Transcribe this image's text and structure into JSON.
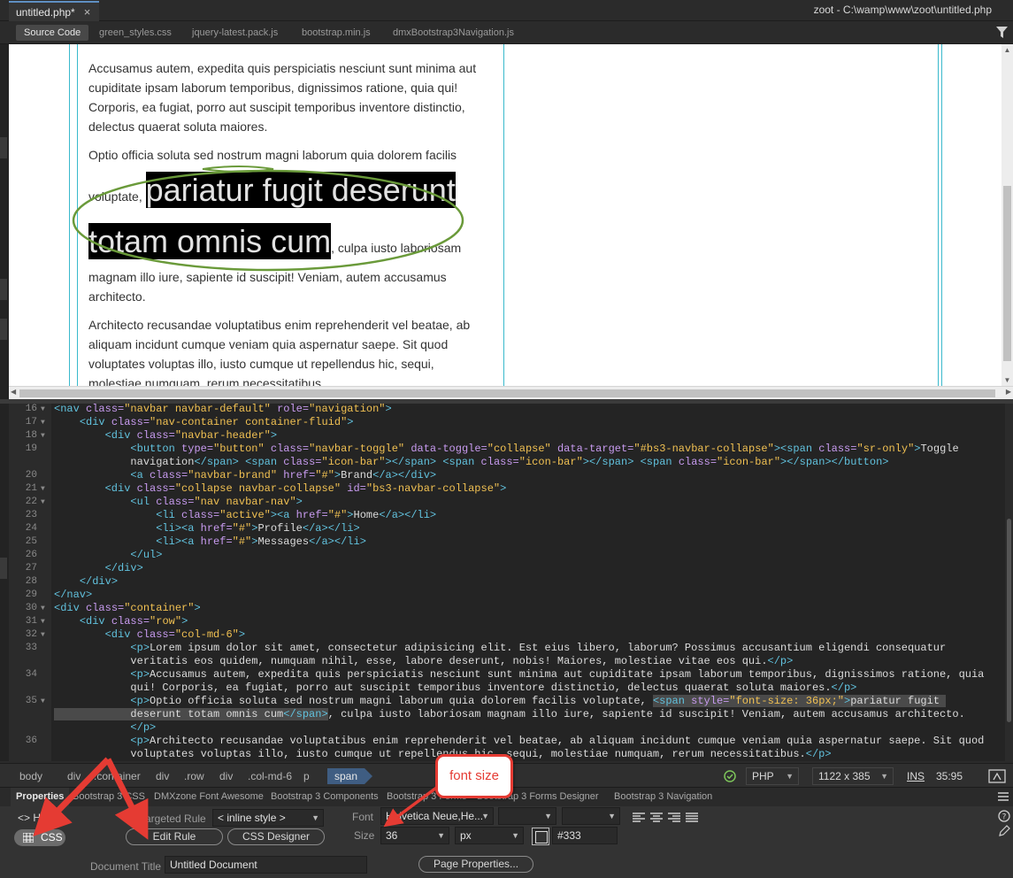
{
  "document_tab": {
    "title": "untitled.php*",
    "close": "×"
  },
  "window_path": "zoot - C:\\wamp\\www\\zoot\\untitled.php",
  "related_files": [
    "Source Code",
    "green_styles.css",
    "jquery-latest.pack.js",
    "bootstrap.min.js",
    "dmxBootstrap3Navigation.js"
  ],
  "live_view": {
    "p1": "Accusamus autem, expedita quis perspiciatis nesciunt sunt minima aut cupiditate ipsam laborum temporibus, dignissimos ratione, quia qui! Corporis, ea fugiat, porro aut suscipit temporibus inventore distinctio, delectus quaerat soluta maiores.",
    "p2_before": "Optio officia soluta sed nostrum magni laborum quia dolorem facilis voluptate, ",
    "p2_span": "pariatur fugit deserunt totam omnis cum",
    "p2_after": ", culpa iusto laboriosam magnam illo iure, sapiente id suscipit! Veniam, autem accusamus architecto.",
    "p3": "Architecto recusandae voluptatibus enim reprehenderit vel beatae, ab aliquam incidunt cumque veniam quia aspernatur saepe. Sit quod voluptates voluptas illo, iusto cumque ut repellendus hic, sequi, molestiae numquam, rerum necessitatibus."
  },
  "code_lines": [
    {
      "n": "16",
      "fold": "▼",
      "html": "<span class=\"tg\">&lt;nav</span> <span class=\"at\">class=</span><span class=\"vl\">\"navbar navbar-default\"</span> <span class=\"at\">role=</span><span class=\"vl\">\"navigation\"</span><span class=\"tg\">&gt;</span>"
    },
    {
      "n": "17",
      "fold": "▼",
      "html": "    <span class=\"tg\">&lt;div</span> <span class=\"at\">class=</span><span class=\"vl\">\"nav-container container-fluid\"</span><span class=\"tg\">&gt;</span>"
    },
    {
      "n": "18",
      "fold": "▼",
      "html": "        <span class=\"tg\">&lt;div</span> <span class=\"at\">class=</span><span class=\"vl\">\"navbar-header\"</span><span class=\"tg\">&gt;</span>"
    },
    {
      "n": "19",
      "fold": "",
      "html": "            <span class=\"tg\">&lt;button</span> <span class=\"at\">type=</span><span class=\"vl\">\"button\"</span> <span class=\"at\">class=</span><span class=\"vl\">\"navbar-toggle\"</span> <span class=\"at\">data-toggle=</span><span class=\"vl\">\"collapse\"</span> <span class=\"at\">data-target=</span><span class=\"vl\">\"#bs3-navbar-collapse\"</span><span class=\"tg\">&gt;&lt;span</span> <span class=\"at\">class=</span><span class=\"vl\">\"sr-only\"</span><span class=\"tg\">&gt;</span>Toggle"
    },
    {
      "n": "",
      "fold": "",
      "html": "            navigation<span class=\"tg\">&lt;/span&gt;</span> <span class=\"tg\">&lt;span</span> <span class=\"at\">class=</span><span class=\"vl\">\"icon-bar\"</span><span class=\"tg\">&gt;&lt;/span&gt;</span> <span class=\"tg\">&lt;span</span> <span class=\"at\">class=</span><span class=\"vl\">\"icon-bar\"</span><span class=\"tg\">&gt;&lt;/span&gt;</span> <span class=\"tg\">&lt;span</span> <span class=\"at\">class=</span><span class=\"vl\">\"icon-bar\"</span><span class=\"tg\">&gt;&lt;/span&gt;&lt;/button&gt;</span>"
    },
    {
      "n": "20",
      "fold": "",
      "html": "            <span class=\"tg\">&lt;a</span> <span class=\"at\">class=</span><span class=\"vl\">\"navbar-brand\"</span> <span class=\"at\">href=</span><span class=\"vl\">\"#\"</span><span class=\"tg\">&gt;</span>Brand<span class=\"tg\">&lt;/a&gt;&lt;/div&gt;</span>"
    },
    {
      "n": "21",
      "fold": "▼",
      "html": "        <span class=\"tg\">&lt;div</span> <span class=\"at\">class=</span><span class=\"vl\">\"collapse navbar-collapse\"</span> <span class=\"at\">id=</span><span class=\"vl\">\"bs3-navbar-collapse\"</span><span class=\"tg\">&gt;</span>"
    },
    {
      "n": "22",
      "fold": "▼",
      "html": "            <span class=\"tg\">&lt;ul</span> <span class=\"at\">class=</span><span class=\"vl\">\"nav navbar-nav\"</span><span class=\"tg\">&gt;</span>"
    },
    {
      "n": "23",
      "fold": "",
      "html": "                <span class=\"tg\">&lt;li</span> <span class=\"at\">class=</span><span class=\"vl\">\"active\"</span><span class=\"tg\">&gt;&lt;a</span> <span class=\"at\">href=</span><span class=\"vl\">\"#\"</span><span class=\"tg\">&gt;</span>Home<span class=\"tg\">&lt;/a&gt;&lt;/li&gt;</span>"
    },
    {
      "n": "24",
      "fold": "",
      "html": "                <span class=\"tg\">&lt;li&gt;&lt;a</span> <span class=\"at\">href=</span><span class=\"vl\">\"#\"</span><span class=\"tg\">&gt;</span>Profile<span class=\"tg\">&lt;/a&gt;&lt;/li&gt;</span>"
    },
    {
      "n": "25",
      "fold": "",
      "html": "                <span class=\"tg\">&lt;li&gt;&lt;a</span> <span class=\"at\">href=</span><span class=\"vl\">\"#\"</span><span class=\"tg\">&gt;</span>Messages<span class=\"tg\">&lt;/a&gt;&lt;/li&gt;</span>"
    },
    {
      "n": "26",
      "fold": "",
      "html": "            <span class=\"tg\">&lt;/ul&gt;</span>"
    },
    {
      "n": "27",
      "fold": "",
      "html": "        <span class=\"tg\">&lt;/div&gt;</span>"
    },
    {
      "n": "28",
      "fold": "",
      "html": "    <span class=\"tg\">&lt;/div&gt;</span>"
    },
    {
      "n": "29",
      "fold": "",
      "html": "<span class=\"tg\">&lt;/nav&gt;</span>"
    },
    {
      "n": "30",
      "fold": "▼",
      "html": "<span class=\"tg\">&lt;div</span> <span class=\"at\">class=</span><span class=\"vl\">\"container\"</span><span class=\"tg\">&gt;</span>"
    },
    {
      "n": "31",
      "fold": "▼",
      "html": "    <span class=\"tg\">&lt;div</span> <span class=\"at\">class=</span><span class=\"vl\">\"row\"</span><span class=\"tg\">&gt;</span>"
    },
    {
      "n": "32",
      "fold": "▼",
      "html": "        <span class=\"tg\">&lt;div</span> <span class=\"at\">class=</span><span class=\"vl\">\"col-md-6\"</span><span class=\"tg\">&gt;</span>"
    },
    {
      "n": "33",
      "fold": "",
      "html": "            <span class=\"tg\">&lt;p&gt;</span>Lorem ipsum dolor sit amet, consectetur adipisicing elit. Est eius libero, laborum? Possimus accusantium eligendi consequatur"
    },
    {
      "n": "",
      "fold": "",
      "html": "            veritatis eos quidem, numquam nihil, esse, labore deserunt, nobis! Maiores, molestiae vitae eos qui.<span class=\"tg\">&lt;/p&gt;</span>"
    },
    {
      "n": "34",
      "fold": "",
      "html": "            <span class=\"tg\">&lt;p&gt;</span>Accusamus autem, expedita quis perspiciatis nesciunt sunt minima aut cupiditate ipsam laborum temporibus, dignissimos ratione, quia"
    },
    {
      "n": "",
      "fold": "",
      "html": "            qui! Corporis, ea fugiat, porro aut suscipit temporibus inventore distinctio, delectus quaerat soluta maiores.<span class=\"tg\">&lt;/p&gt;</span>"
    },
    {
      "n": "35",
      "fold": "▼",
      "html": "            <span class=\"tg\">&lt;p&gt;</span>Optio officia soluta sed nostrum magni laborum quia dolorem facilis voluptate, <span class=\"hl\"><span class=\"tg\">&lt;span</span> <span class=\"at\">style=</span><span class=\"vl\">\"font-size: 36px;\"</span><span class=\"tg\">&gt;</span>pariatur fugit </span>"
    },
    {
      "n": "",
      "fold": "",
      "html": "<span class=\"hl\">            deserunt totam omnis cum<span class=\"tg\">&lt;/span&gt;</span></span>, culpa iusto laboriosam magnam illo iure, sapiente id suscipit! Veniam, autem accusamus architecto."
    },
    {
      "n": "",
      "fold": "",
      "html": "            <span class=\"tg\">&lt;/p&gt;</span>"
    },
    {
      "n": "36",
      "fold": "",
      "html": "            <span class=\"tg\">&lt;p&gt;</span>Architecto recusandae voluptatibus enim reprehenderit vel beatae, ab aliquam incidunt cumque veniam quia aspernatur saepe. Sit quod"
    },
    {
      "n": "",
      "fold": "",
      "html": "            voluptates voluptas illo, iusto cumque ut repellendus hic, sequi, molestiae numquam, rerum necessitatibus.<span class=\"tg\">&lt;/p&gt;</span>"
    }
  ],
  "breadcrumbs": [
    "body",
    "div",
    ".container",
    "div",
    ".row",
    "div",
    ".col-md-6",
    "p",
    "span"
  ],
  "status": {
    "language": "PHP",
    "dimensions": "1122 x 385",
    "mode": "INS",
    "cursor": "35:95"
  },
  "properties": {
    "tabs": [
      "Properties",
      "Bootstrap 3 CSS",
      "DMXzone Font Awesome",
      "Bootstrap 3 Components",
      "Bootstrap 3 Forms",
      "Bootstrap 3 Forms Designer",
      "Bootstrap 3 Navigation"
    ],
    "html_label": "HTML",
    "css_label": "CSS",
    "targeted_rule_label": "Targeted Rule",
    "targeted_rule_value": "< inline style >",
    "edit_rule": "Edit Rule",
    "css_designer": "CSS Designer",
    "font_label": "Font",
    "font_value": "Helvetica Neue,He...",
    "size_label": "Size",
    "size_value": "36",
    "size_unit": "px",
    "color_value": "#333",
    "doc_title_label": "Document Title",
    "doc_title_value": "Untitled Document",
    "page_properties": "Page Properties..."
  },
  "annotation": {
    "callout": "font size",
    "arrow_color": "#e53b33",
    "ellipse_color": "#6a9a3a"
  }
}
